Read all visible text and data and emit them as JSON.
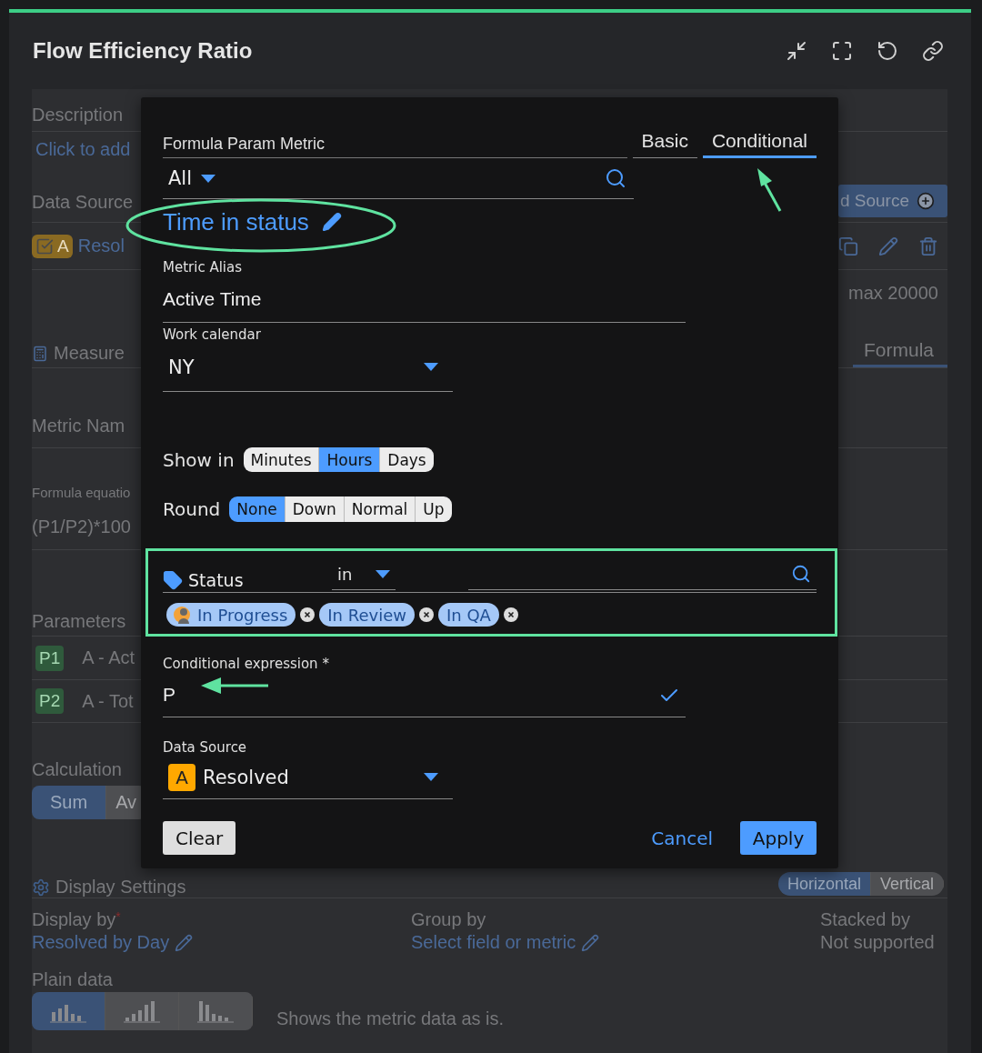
{
  "widget": {
    "title": "Flow Efficiency Ratio"
  },
  "background": {
    "description": {
      "label": "Description",
      "link": "Click to add"
    },
    "data_source": {
      "label": "Data Source",
      "add_button": "d Source",
      "item": {
        "checked": true,
        "badge": "A",
        "name": "Resol"
      },
      "limit": "max 20000"
    },
    "measure": {
      "label": "Measure",
      "tab": "Formula"
    },
    "metric_name": {
      "label": "Metric Nam"
    },
    "formula": {
      "label": "Formula equatio",
      "value": "(P1/P2)*100"
    },
    "parameters": {
      "label": "Parameters",
      "items": [
        {
          "tag": "P1",
          "name": "A - Act"
        },
        {
          "tag": "P2",
          "name": "A - Tot"
        }
      ]
    },
    "calculation": {
      "label": "Calculation",
      "options": [
        {
          "label": "Sum",
          "selected": true
        },
        {
          "label": "Av",
          "selected": false
        }
      ]
    },
    "display_settings": {
      "label": "Display Settings",
      "orientation": [
        {
          "label": "Horizontal",
          "selected": true
        },
        {
          "label": "Vertical",
          "selected": false
        }
      ],
      "display_by": {
        "label": "Display by",
        "required_mark": "*",
        "value": "Resolved by Day"
      },
      "group_by": {
        "label": "Group by",
        "value": "Select field or metric"
      },
      "stacked_by": {
        "label": "Stacked by",
        "value": "Not supported"
      }
    },
    "plain_data": {
      "label": "Plain data",
      "chart_types": [
        {
          "kind": "mixed",
          "selected": true
        },
        {
          "kind": "ascending",
          "selected": false
        },
        {
          "kind": "descending",
          "selected": false
        }
      ],
      "hint": "Shows the metric data as is."
    }
  },
  "dialog": {
    "param_metric": {
      "label": "Formula Param Metric",
      "value": "All"
    },
    "tabs": [
      {
        "label": "Basic",
        "selected": false
      },
      {
        "label": "Conditional",
        "selected": true
      }
    ],
    "metric_type": "Time in status",
    "alias": {
      "label": "Metric Alias",
      "value": "Active Time"
    },
    "work_calendar": {
      "label": "Work calendar",
      "value": "NY"
    },
    "show_in": {
      "label": "Show in",
      "options": [
        {
          "label": "Minutes",
          "selected": false
        },
        {
          "label": "Hours",
          "selected": true
        },
        {
          "label": "Days",
          "selected": false
        }
      ]
    },
    "round": {
      "label": "Round",
      "options": [
        {
          "label": "None",
          "selected": true
        },
        {
          "label": "Down",
          "selected": false
        },
        {
          "label": "Normal",
          "selected": false
        },
        {
          "label": "Up",
          "selected": false
        }
      ]
    },
    "filter": {
      "field": "Status",
      "operator": "in",
      "values": [
        {
          "label": "In Progress",
          "kind": "avatar"
        },
        {
          "label": "In Review",
          "kind": "plain"
        },
        {
          "label": "In QA",
          "kind": "plain"
        }
      ]
    },
    "conditional_expression": {
      "label": "Conditional expression *",
      "value": "P",
      "valid": true
    },
    "data_source": {
      "label": "Data Source",
      "badge": "A",
      "value": "Resolved"
    },
    "buttons": {
      "clear": "Clear",
      "cancel": "Cancel",
      "apply": "Apply"
    }
  }
}
